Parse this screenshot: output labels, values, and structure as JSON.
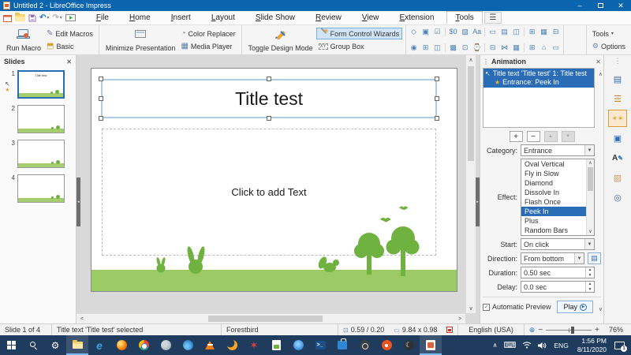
{
  "titlebar": {
    "title": "Untitled 2 - LibreOffice Impress",
    "minimize_glyph": "–",
    "close_glyph": "✕"
  },
  "menubar": {
    "tabs": [
      "File",
      "Home",
      "Insert",
      "Layout",
      "Slide Show",
      "Review",
      "View",
      "Extension",
      "Tools"
    ],
    "active_tab": "Tools",
    "hamburger_glyph": "☰"
  },
  "toolbar": {
    "run_macro": "Run Macro",
    "edit_macros": "Edit Macros",
    "basic": "Basic",
    "minimize_presentation": "Minimize Presentation",
    "color_replacer": "Color Replacer",
    "media_player": "Media Player",
    "toggle_design_mode": "Toggle Design Mode",
    "form_control_wizards": "Form Control Wizards",
    "group_box": "Group Box",
    "group_box_glyph": "XY",
    "tools_menu": "Tools",
    "tools_caret": "▾",
    "options": "Options",
    "options_glyph": "⚙",
    "form_icons_row1": [
      "◇",
      "▣",
      "☑",
      "$0",
      "▨",
      "Aa",
      "▭",
      "▤",
      "◫",
      "⊞",
      "▦",
      "⊟"
    ],
    "form_icons_row2": [
      "◉",
      "⊞",
      "◫",
      "▩",
      "⊡",
      "⌚",
      "⊟",
      "⋈",
      "▦",
      "⊞",
      "⌂",
      "▭"
    ]
  },
  "slides_panel": {
    "title": "Slides",
    "close_glyph": "✕",
    "slides": [
      {
        "number": "1"
      },
      {
        "number": "2"
      },
      {
        "number": "3"
      },
      {
        "number": "4"
      }
    ],
    "anim_star_glyph": "★",
    "cursor_glyph": "↖"
  },
  "slide": {
    "title": "Title test",
    "placeholder": "Click to add Text",
    "thumb_title": "Title test"
  },
  "animation": {
    "title": "Animation",
    "grip_glyph": "⋮",
    "close_glyph": "✕",
    "scroll_up_glyph": "∧",
    "scroll_down_glyph": "∨",
    "item_line1": "Title text 'Title test' 1: Title test",
    "item_line2": "Entrance: Peek In",
    "item_cursor_glyph": "↖",
    "item_star_glyph": "★",
    "add_glyph": "+",
    "remove_glyph": "−",
    "up_glyph": "▲",
    "down_glyph": "▼",
    "category_label": "Category:",
    "category_value": "Entrance",
    "effect_label": "Effect:",
    "effects": [
      "Oval Vertical",
      "Fly in Slow",
      "Diamond",
      "Dissolve In",
      "Flash Once",
      "Peek In",
      "Plus",
      "Random Bars"
    ],
    "selected_effect": "Peek In",
    "start_label": "Start:",
    "start_value": "On click",
    "direction_label": "Direction:",
    "direction_value": "From bottom",
    "direction_options_glyph": "▤",
    "duration_label": "Duration:",
    "duration_value": "0.50 sec",
    "delay_label": "Delay:",
    "delay_value": "0.0 sec",
    "automatic_preview": "Automatic Preview",
    "checkbox_glyph": "✓",
    "play": "Play",
    "play_glyph": "▶"
  },
  "sidebar_tabs": {
    "grip_glyph": "⋮",
    "properties_glyph": "▤",
    "transition_glyph": "☰",
    "animation_glyph": "✶✶",
    "master_glyph": "▣",
    "styles_glyph": "A",
    "styles_pen_glyph": "✎",
    "gallery_glyph": "▨",
    "navigator_glyph": "◎"
  },
  "statusbar": {
    "slide_info": "Slide 1 of 4",
    "selection": "Title text 'Title test' selected",
    "template": "Forestbird",
    "position": "0.59 / 0.20",
    "position_glyph": "⊡",
    "size": "9.84 x 0.98",
    "size_glyph": "▭",
    "language": "English (USA)",
    "fit_glyph": "⊕",
    "zoom_minus": "−",
    "zoom_plus": "+",
    "zoom": "76%"
  },
  "taskbar": {
    "lang": "ENG",
    "time": "1:56 PM",
    "date": "8/11/2020",
    "badge": "1",
    "tray_chevron": "∧",
    "keyboard_glyph": "⌨",
    "moon_glyph": "☾",
    "redstar_glyph": "✶",
    "pshell_glyph": ">_",
    "edge_glyph": "e"
  }
}
